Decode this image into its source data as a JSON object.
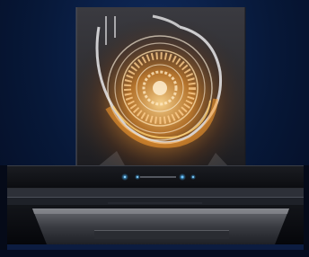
{
  "image": {
    "kind": "product-render",
    "subject": "range-hood",
    "colors": {
      "background": "#0a1f4a",
      "glow": "#ffb040",
      "panel": "#2a2a30",
      "body": "#111318",
      "indicator": "#35a8ff"
    }
  }
}
